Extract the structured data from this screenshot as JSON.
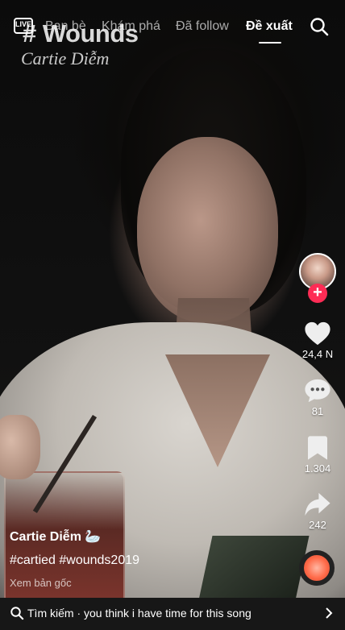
{
  "video": {
    "watermark_brand": "# Wounds",
    "watermark_signature": "Cartie Diễm"
  },
  "topnav": {
    "live_label": "LIVE",
    "tabs": [
      {
        "label": "Bạn bè"
      },
      {
        "label": "Khám phá"
      },
      {
        "label": "Đã follow"
      },
      {
        "label": "Đề xuất",
        "active": true
      }
    ]
  },
  "rail": {
    "likes": "24,4 N",
    "comments": "81",
    "saves": "1.304",
    "shares": "242"
  },
  "caption": {
    "author": "Cartie Diễm 🦢",
    "hashtags": "#cartied #wounds2019",
    "translate_label": "Xem bản gốc"
  },
  "bottom_search": {
    "text": "Tìm kiếm · you think i have time for this song"
  },
  "colors": {
    "follow_red": "#fe2c55",
    "background": "#000000",
    "bottom_bar": "#171717"
  }
}
